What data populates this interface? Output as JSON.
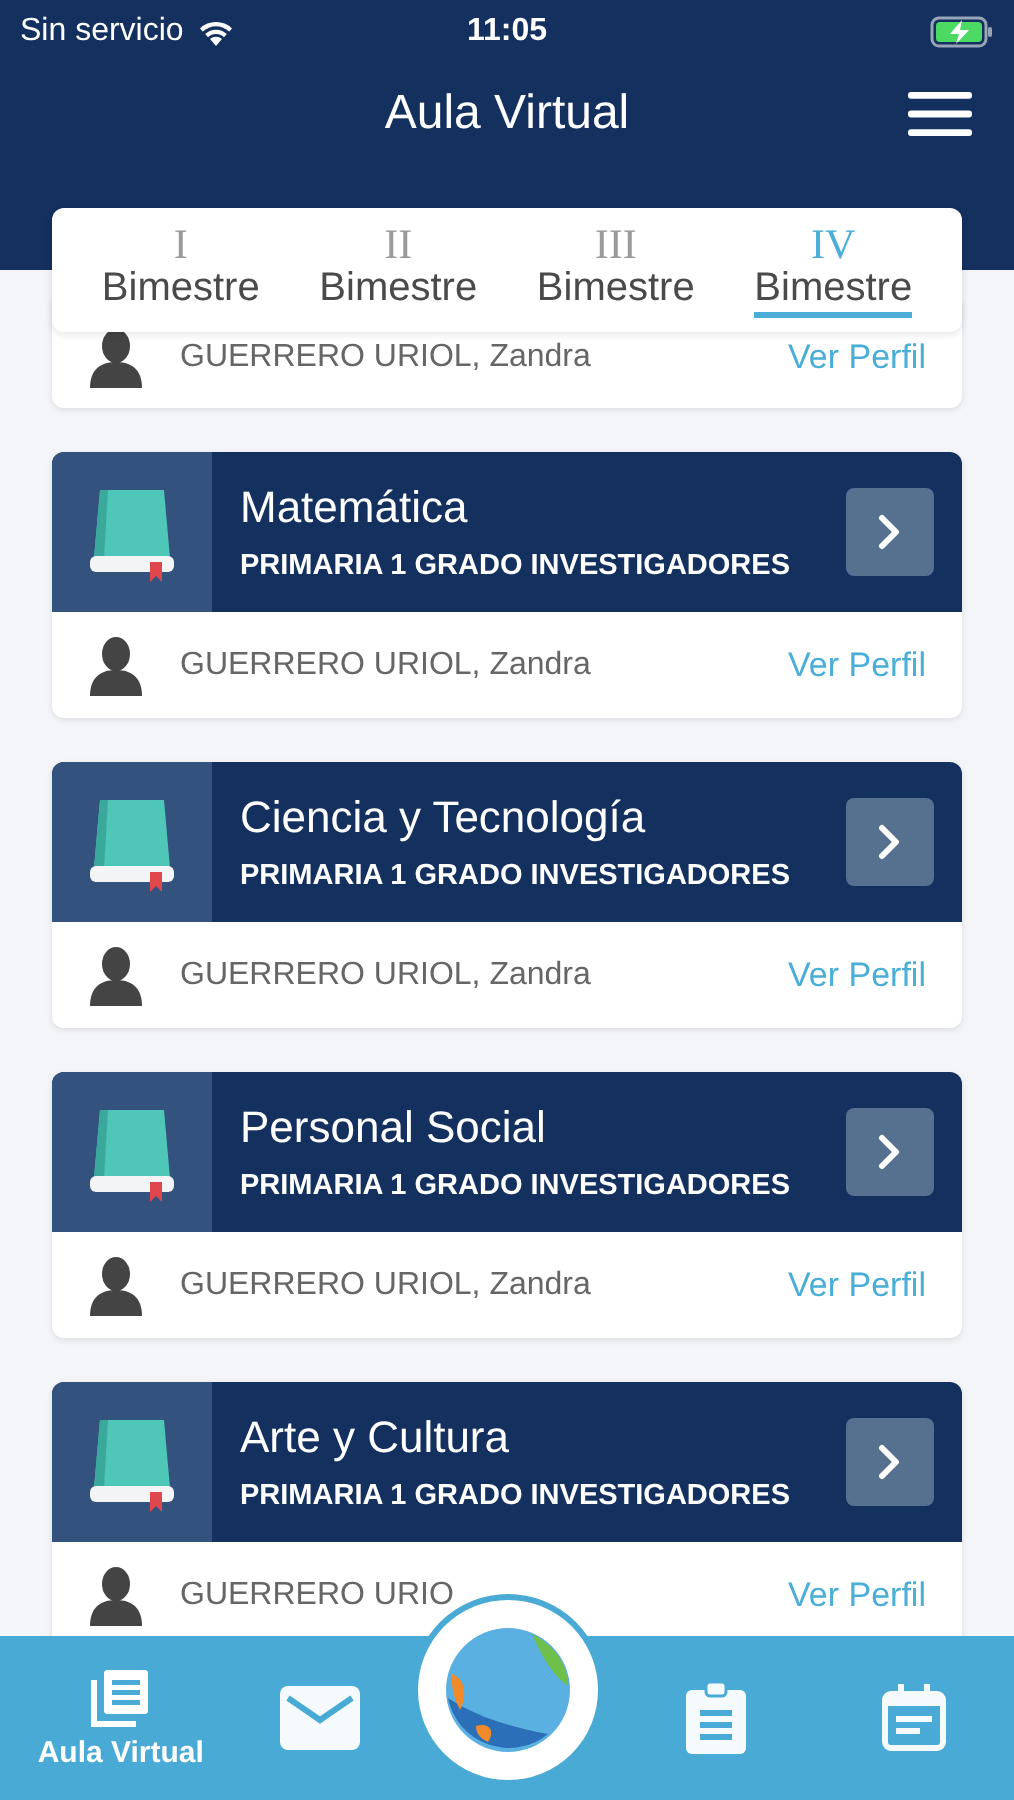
{
  "status_bar": {
    "carrier": "Sin servicio",
    "time": "11:05"
  },
  "header": {
    "title": "Aula Virtual"
  },
  "tabs": [
    {
      "numeral": "I",
      "label": "Bimestre",
      "selected": false
    },
    {
      "numeral": "II",
      "label": "Bimestre",
      "selected": false
    },
    {
      "numeral": "III",
      "label": "Bimestre",
      "selected": false
    },
    {
      "numeral": "IV",
      "label": "Bimestre",
      "selected": true
    }
  ],
  "courses": [
    {
      "teacher": "GUERRERO URIOL, Zandra",
      "link": "Ver Perfil"
    },
    {
      "title": "Matemática",
      "subtitle": "PRIMARIA 1 GRADO INVESTIGADORES",
      "teacher": "GUERRERO URIOL, Zandra",
      "link": "Ver Perfil"
    },
    {
      "title": "Ciencia y Tecnología",
      "subtitle": "PRIMARIA 1 GRADO INVESTIGADORES",
      "teacher": "GUERRERO URIOL, Zandra",
      "link": "Ver Perfil"
    },
    {
      "title": "Personal Social",
      "subtitle": "PRIMARIA 1 GRADO INVESTIGADORES",
      "teacher": "GUERRERO URIOL, Zandra",
      "link": "Ver Perfil"
    },
    {
      "title": "Arte y Cultura",
      "subtitle": "PRIMARIA 1 GRADO INVESTIGADORES",
      "teacher": "GUERRERO URIO",
      "link": "Ver Perfil"
    }
  ],
  "bottom_nav": [
    {
      "kind": "courses",
      "label": "Aula Virtual",
      "selected": true
    },
    {
      "kind": "messages",
      "selected": false
    },
    {
      "kind": "tasks",
      "selected": false
    },
    {
      "kind": "calendar",
      "selected": false
    }
  ]
}
